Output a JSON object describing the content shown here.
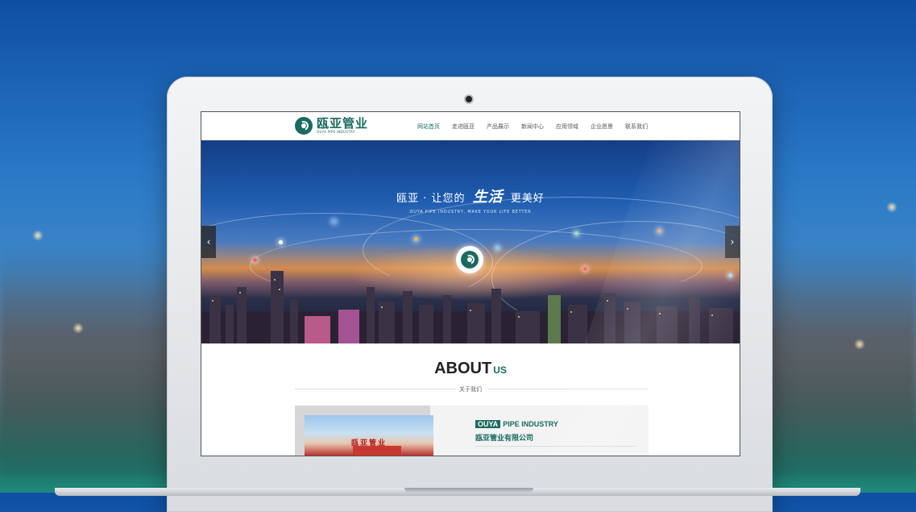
{
  "site": {
    "logo": {
      "name_cn": "瓯亚管业",
      "name_en": "OUYA PIPE INDUSTRY"
    },
    "nav": [
      {
        "label": "网站首页",
        "active": true
      },
      {
        "label": "走进瓯亚",
        "active": false
      },
      {
        "label": "产品展示",
        "active": false
      },
      {
        "label": "新闻中心",
        "active": false
      },
      {
        "label": "应用领域",
        "active": false
      },
      {
        "label": "企业愿景",
        "active": false
      },
      {
        "label": "联系我们",
        "active": false
      }
    ],
    "banner": {
      "headline_pre": "瓯亚 · 让您的",
      "headline_script": "生活",
      "headline_post": "更美好",
      "subtitle": "OUYA PIPE INDUSTRY, MAKE YOUR LIFE BETTER",
      "prev_icon": "chevron-left-icon",
      "next_icon": "chevron-right-icon"
    },
    "about": {
      "title_main": "ABOUT",
      "title_sub": "US",
      "caption": "关于我们",
      "company_tag": "OUYA",
      "company_en_rest": "PIPE INDUSTRY",
      "company_cn": "瓯亚管业有限公司",
      "photo_sign": "瓯亚管业"
    }
  },
  "colors": {
    "brand": "#1b6a5f",
    "background_top": "#0f4fa3",
    "background_bottom": "#1d8a7b"
  }
}
